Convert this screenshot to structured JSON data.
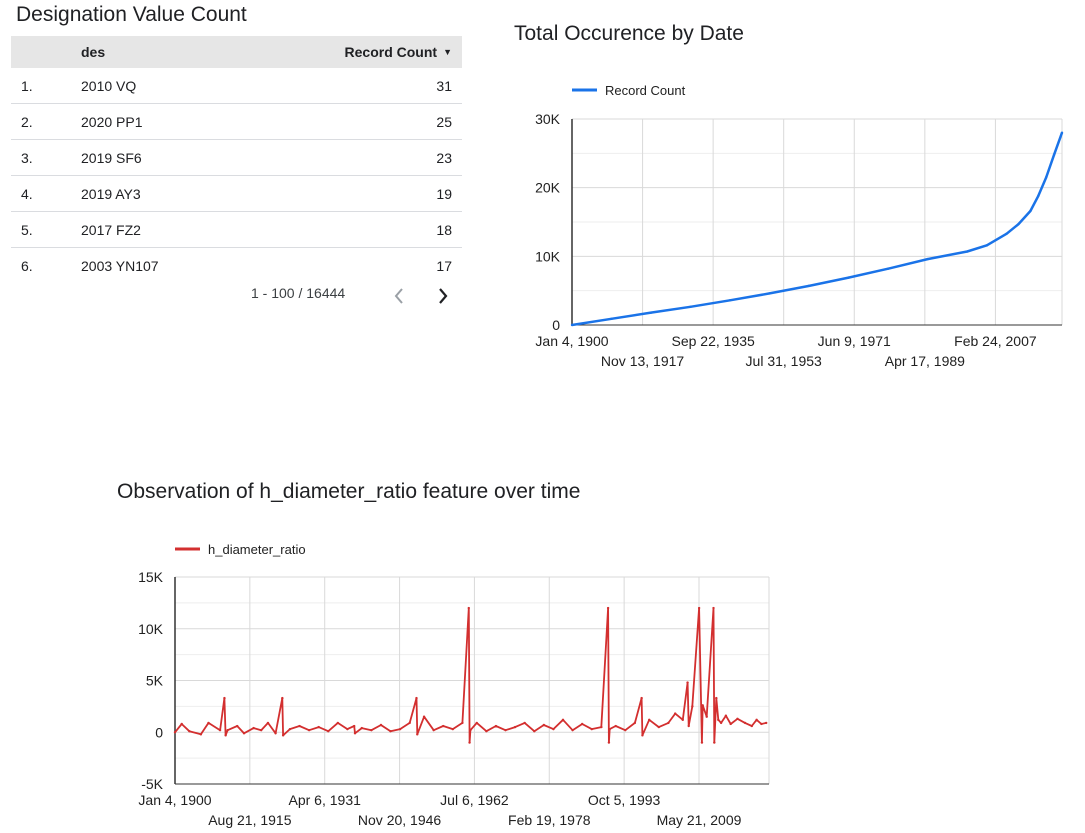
{
  "table": {
    "title": "Designation Value Count",
    "headers": {
      "index": "",
      "des": "des",
      "count": "Record Count"
    },
    "sort_icon": "sort-desc-triangle",
    "rows": [
      {
        "index": "1.",
        "des": "2010 VQ",
        "count": "31"
      },
      {
        "index": "2.",
        "des": "2020 PP1",
        "count": "25"
      },
      {
        "index": "3.",
        "des": "2019 SF6",
        "count": "23"
      },
      {
        "index": "4.",
        "des": "2019 AY3",
        "count": "19"
      },
      {
        "index": "5.",
        "des": "2017 FZ2",
        "count": "18"
      },
      {
        "index": "6.",
        "des": "2003 YN107",
        "count": "17"
      }
    ],
    "pagination": "1 - 100 / 16444",
    "prev_icon": "chevron-left-icon",
    "next_icon": "chevron-right-icon"
  },
  "colors": {
    "line": "#1a73e8",
    "ratio": "#d32f2f",
    "grid": "#d9d9d9",
    "header_bg": "#e6e6e6"
  },
  "chart_data": [
    {
      "type": "line",
      "title": "Total Occurence by Date",
      "xlabel": "",
      "ylabel": "",
      "x_type": "date",
      "xlim": [
        "1900-01-04",
        "2024-01-01"
      ],
      "ylim": [
        0,
        30000
      ],
      "yticks": [
        0,
        10000,
        20000,
        30000
      ],
      "ytick_labels": [
        "0",
        "10K",
        "20K",
        "30K"
      ],
      "xticks": [
        "1900-01-04",
        "1917-11-13",
        "1935-09-22",
        "1953-07-31",
        "1971-06-09",
        "1989-04-17",
        "2007-02-24"
      ],
      "xtick_labels": [
        "Jan 4, 1900",
        "Nov 13, 1917",
        "Sep 22, 1935",
        "Jul 31, 1953",
        "Jun 9, 1971",
        "Apr 17, 1989",
        "Feb 24, 2007"
      ],
      "legend_position": "top-left",
      "grid": true,
      "series": [
        {
          "name": "Record Count",
          "color": "#1a73e8",
          "x": [
            "1900-01-04",
            "1910-01-01",
            "1920-01-01",
            "1930-01-01",
            "1940-01-01",
            "1950-01-01",
            "1960-01-01",
            "1970-01-01",
            "1980-01-01",
            "1990-01-01",
            "2000-01-01",
            "2005-01-01",
            "2010-01-01",
            "2013-01-01",
            "2016-01-01",
            "2018-01-01",
            "2020-01-01",
            "2022-01-01",
            "2024-01-01"
          ],
          "y": [
            0,
            900,
            1800,
            2650,
            3600,
            4600,
            5700,
            6900,
            8200,
            9600,
            10700,
            11600,
            13300,
            14700,
            16600,
            18800,
            21500,
            24800,
            28000
          ]
        }
      ]
    },
    {
      "type": "line",
      "title": "Observation of h_diameter_ratio feature over time",
      "xlabel": "",
      "ylabel": "",
      "x_type": "date",
      "xlim": [
        "1900-01-04",
        "2024-01-01"
      ],
      "ylim": [
        -5000,
        15000
      ],
      "yticks": [
        -5000,
        0,
        5000,
        10000,
        15000
      ],
      "ytick_labels": [
        "-5K",
        "0",
        "5K",
        "10K",
        "15K"
      ],
      "xticks": [
        "1900-01-04",
        "1915-08-21",
        "1931-04-06",
        "1946-11-20",
        "1962-07-06",
        "1978-02-19",
        "1993-10-05",
        "2009-05-21"
      ],
      "xtick_labels": [
        "Jan 4, 1900",
        "Aug 21, 1915",
        "Apr 6, 1931",
        "Nov 20, 1946",
        "Jul 6, 1962",
        "Feb 19, 1978",
        "Oct 5, 1993",
        "May 21, 2009"
      ],
      "legend_position": "top-left",
      "grid": true,
      "series": [
        {
          "name": "h_diameter_ratio",
          "color": "#d32f2f",
          "x": [
            "1900-01-04",
            "1901-06-01",
            "1903-01-01",
            "1905-06-01",
            "1907-01-01",
            "1909-06-01",
            "1910-05-01",
            "1910-08-01",
            "1911-01-01",
            "1913-01-01",
            "1914-06-01",
            "1916-06-01",
            "1918-01-01",
            "1919-06-01",
            "1921-01-01",
            "1922-06-01",
            "1922-08-01",
            "1924-01-01",
            "1926-01-01",
            "1928-01-01",
            "1930-01-01",
            "1932-01-01",
            "1934-01-01",
            "1936-01-01",
            "1937-06-01",
            "1937-08-01",
            "1939-01-01",
            "1941-01-01",
            "1943-01-01",
            "1945-01-01",
            "1947-01-01",
            "1949-01-01",
            "1950-06-01",
            "1950-08-01",
            "1952-01-01",
            "1954-01-01",
            "1956-01-01",
            "1958-01-01",
            "1960-01-01",
            "1961-05-01",
            "1961-07-01",
            "1961-09-01",
            "1963-01-01",
            "1965-01-01",
            "1967-01-01",
            "1969-01-01",
            "1971-01-01",
            "1973-01-01",
            "1975-01-01",
            "1977-01-01",
            "1979-01-01",
            "1981-01-01",
            "1983-01-01",
            "1985-01-01",
            "1987-01-01",
            "1989-01-01",
            "1990-06-01",
            "1990-08-01",
            "1990-10-01",
            "1992-01-01",
            "1994-01-01",
            "1996-01-01",
            "1997-06-01",
            "1997-08-01",
            "1999-01-01",
            "2001-01-01",
            "2003-01-01",
            "2004-06-01",
            "2006-01-01",
            "2007-01-01",
            "2007-04-01",
            "2008-01-01",
            "2009-06-01",
            "2010-01-01",
            "2010-03-01",
            "2011-01-01",
            "2012-06-01",
            "2012-08-01",
            "2013-01-01",
            "2013-06-01",
            "2014-01-01",
            "2015-01-01",
            "2016-01-01",
            "2017-06-01",
            "2019-01-01",
            "2020-06-01",
            "2021-06-01",
            "2022-06-01",
            "2023-06-01"
          ],
          "y": [
            0,
            800,
            100,
            -200,
            900,
            200,
            3300,
            -300,
            200,
            600,
            -100,
            400,
            200,
            900,
            -100,
            3300,
            -300,
            300,
            600,
            200,
            500,
            100,
            900,
            300,
            600,
            -100,
            400,
            200,
            700,
            100,
            300,
            900,
            3300,
            -200,
            1500,
            200,
            600,
            300,
            900,
            12000,
            -1000,
            200,
            900,
            100,
            600,
            200,
            500,
            900,
            100,
            700,
            300,
            1200,
            200,
            800,
            300,
            500,
            12000,
            -1000,
            300,
            600,
            200,
            900,
            3300,
            -300,
            1200,
            500,
            900,
            1800,
            1200,
            4800,
            600,
            2500,
            12000,
            -1000,
            2600,
            1500,
            12000,
            -1000,
            3300,
            1200,
            900,
            1600,
            800,
            1300,
            900,
            600,
            1200,
            800,
            900
          ]
        }
      ]
    }
  ]
}
